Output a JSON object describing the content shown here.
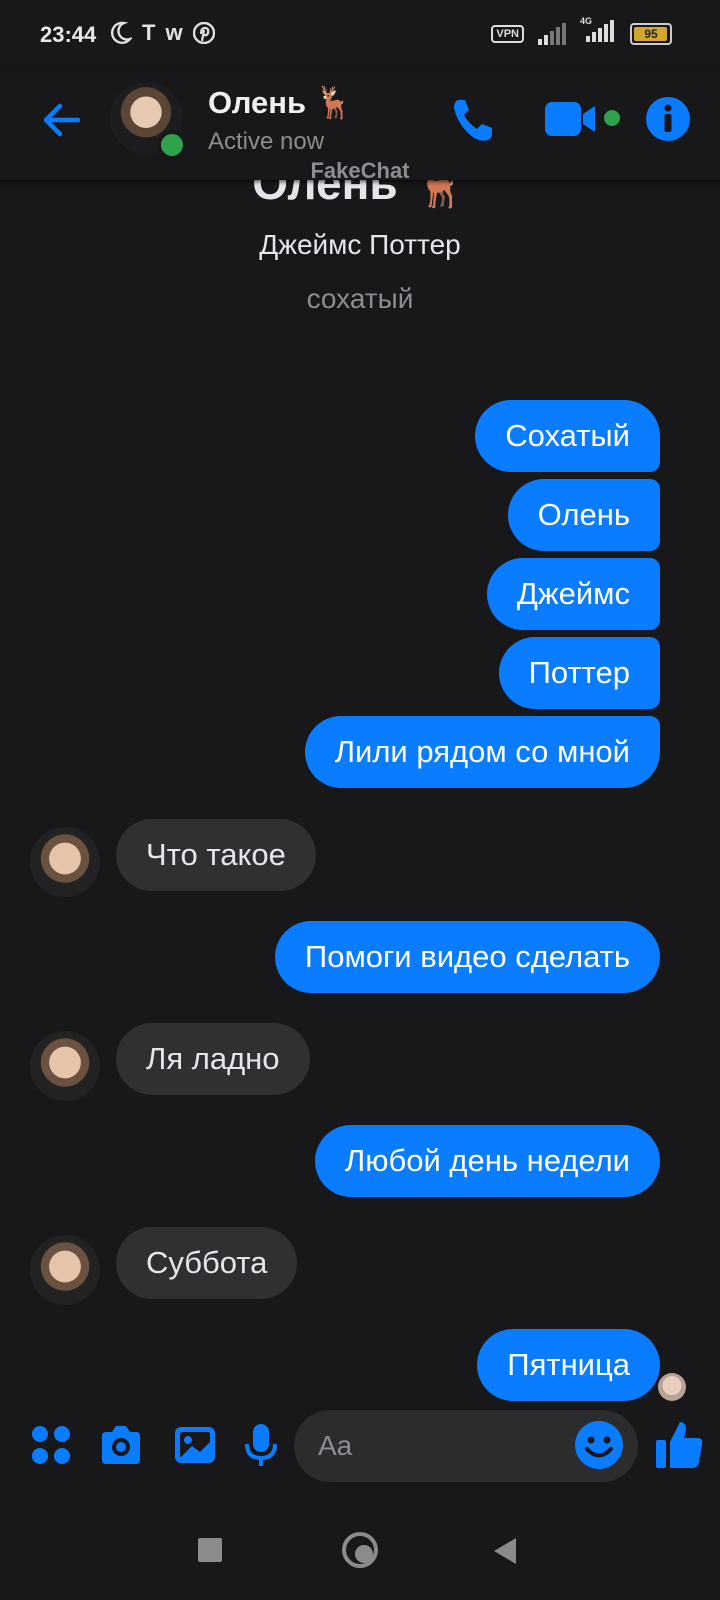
{
  "status_bar": {
    "time": "23:44",
    "left_icons": [
      "moon-icon",
      "t-icon",
      "w-icon",
      "pinterest-icon"
    ],
    "vpn": "VPN",
    "network": "4G",
    "battery": "95"
  },
  "header": {
    "name": "Олень 🦌",
    "status": "Active now"
  },
  "watermark": "FakeChat",
  "profile": {
    "name": "Олень 🦌",
    "full_name": "Джеймс Поттер",
    "nickname": "сохатый"
  },
  "messages": [
    {
      "dir": "out",
      "text": "Сохатый"
    },
    {
      "dir": "out",
      "text": "Олень"
    },
    {
      "dir": "out",
      "text": "Джеймс"
    },
    {
      "dir": "out",
      "text": "Поттер"
    },
    {
      "dir": "out",
      "text": "Лили рядом со мной"
    },
    {
      "dir": "in",
      "text": "Что такое"
    },
    {
      "dir": "out",
      "text": "Помоги видео сделать"
    },
    {
      "dir": "in",
      "text": "Ля ладно"
    },
    {
      "dir": "out",
      "text": "Любой день недели"
    },
    {
      "dir": "in",
      "text": "Суббота"
    },
    {
      "dir": "out",
      "text": "Пятница"
    }
  ],
  "composer": {
    "placeholder": "Aa"
  },
  "colors": {
    "accent": "#0a7cff",
    "background": "#18181a",
    "incoming_bubble": "#303033",
    "online": "#31a24c"
  }
}
